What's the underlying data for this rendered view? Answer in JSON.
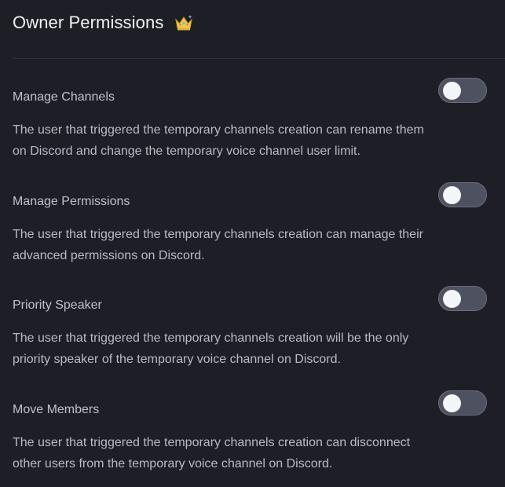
{
  "header": {
    "title": "Owner Permissions",
    "icon": "crown-icon"
  },
  "settings": [
    {
      "label": "Manage Channels",
      "description": "The user that triggered the temporary channels creation can rename them on Discord and change the temporary voice channel user limit.",
      "enabled": false
    },
    {
      "label": "Manage Permissions",
      "description": "The user that triggered the temporary channels creation can manage their advanced permissions on Discord.",
      "enabled": false
    },
    {
      "label": "Priority Speaker",
      "description": "The user that triggered the temporary channels creation will be the only priority speaker of the temporary voice channel on Discord.",
      "enabled": false
    },
    {
      "label": "Move Members",
      "description": "The user that triggered the temporary channels creation can disconnect other users from the temporary voice channel on Discord.",
      "enabled": false
    }
  ],
  "colors": {
    "background": "#1e1f26",
    "toggle_off_track": "#4e5160",
    "toggle_knob": "#f4f5f8",
    "crown": "#f2c94c"
  }
}
